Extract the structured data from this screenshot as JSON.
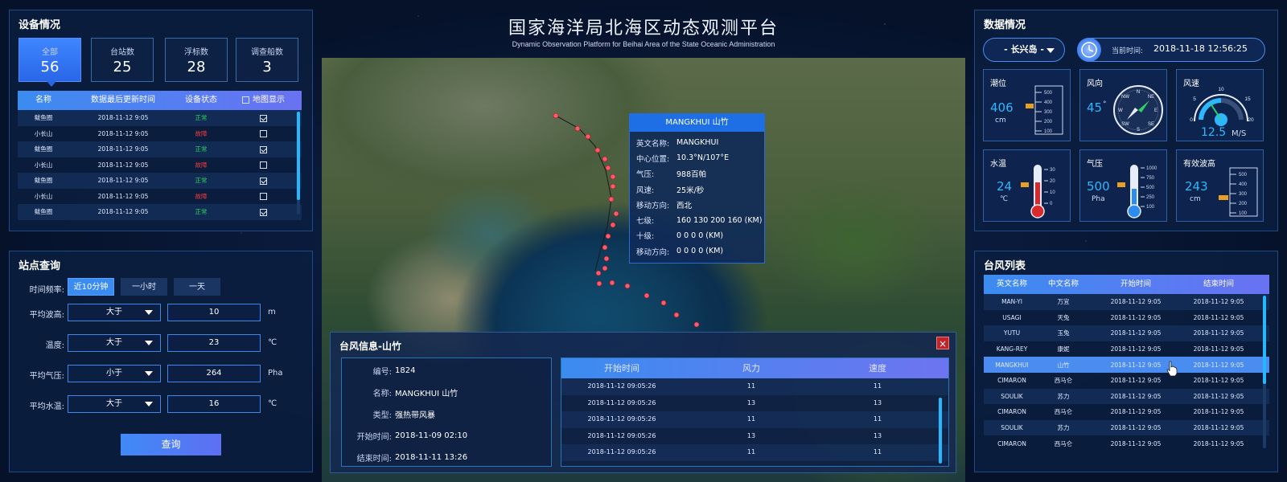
{
  "header": {
    "title": "国家海洋局北海区动态观测平台",
    "subtitle": "Dynamic Observation Platform for Beihai Area of the State Oceanic Administration"
  },
  "device_panel": {
    "title": "设备情况",
    "stats": [
      {
        "label": "全部",
        "value": "56"
      },
      {
        "label": "台站数",
        "value": "25"
      },
      {
        "label": "浮标数",
        "value": "28"
      },
      {
        "label": "调查船数",
        "value": "3"
      }
    ],
    "columns": [
      "名称",
      "数据最后更新时间",
      "设备状态",
      "地图显示"
    ],
    "rows": [
      {
        "name": "鲅鱼圈",
        "time": "2018-11-12 9:05",
        "status": "正常",
        "ok": true,
        "shown": true
      },
      {
        "name": "小长山",
        "time": "2018-11-12 9:05",
        "status": "故障",
        "ok": false,
        "shown": false
      },
      {
        "name": "鲅鱼圈",
        "time": "2018-11-12 9:05",
        "status": "正常",
        "ok": true,
        "shown": true
      },
      {
        "name": "小长山",
        "time": "2018-11-12 9:05",
        "status": "故障",
        "ok": false,
        "shown": false
      },
      {
        "name": "鲅鱼圈",
        "time": "2018-11-12 9:05",
        "status": "正常",
        "ok": true,
        "shown": true
      },
      {
        "name": "小长山",
        "time": "2018-11-12 9:05",
        "status": "故障",
        "ok": false,
        "shown": false
      },
      {
        "name": "鲅鱼圈",
        "time": "2018-11-12 9:05",
        "status": "正常",
        "ok": true,
        "shown": true
      }
    ]
  },
  "station_query": {
    "title": "站点查询",
    "freq_label": "时间频率:",
    "freq_options": [
      "近10分钟",
      "一小时",
      "一天"
    ],
    "filters": [
      {
        "label": "平均波高:",
        "op": "大于",
        "value": "10",
        "unit": "m"
      },
      {
        "label": "温度:",
        "op": "大于",
        "value": "23",
        "unit": "℃"
      },
      {
        "label": "平均气压:",
        "op": "小于",
        "value": "264",
        "unit": "Pha"
      },
      {
        "label": "平均水温:",
        "op": "大于",
        "value": "16",
        "unit": "℃"
      }
    ],
    "query_button": "查询"
  },
  "data_panel": {
    "title": "数据情况",
    "location": "- 长兴岛 -",
    "time_label": "当前时间:",
    "time_value": "2018-11-18 12:56:25",
    "tiles": {
      "tide": {
        "title": "潮位",
        "value": "406",
        "unit": "cm",
        "ticks": [
          "500",
          "400",
          "300",
          "200",
          "100"
        ]
      },
      "wind_dir": {
        "title": "风向",
        "value": "45",
        "unit": "°",
        "compass": [
          "N",
          "NE",
          "E",
          "SE",
          "S",
          "SW",
          "W",
          "NW"
        ]
      },
      "wind_speed": {
        "title": "风速",
        "value": "12.5",
        "unit": "M/S",
        "ticks": [
          "0",
          "5",
          "10",
          "15",
          "20"
        ]
      },
      "water_temp": {
        "title": "水温",
        "value": "24",
        "unit": "℃",
        "ticks": [
          "30",
          "20",
          "10",
          "0"
        ]
      },
      "pressure": {
        "title": "气压",
        "value": "500",
        "unit": "Pha",
        "ticks": [
          "1000",
          "750",
          "500",
          "250",
          "100"
        ]
      },
      "wave_height": {
        "title": "有效波高",
        "value": "243",
        "unit": "cm",
        "ticks": [
          "500",
          "400",
          "300",
          "200",
          "100"
        ]
      }
    }
  },
  "typhoon_list": {
    "title": "台风列表",
    "columns": [
      "英文名称",
      "中文名称",
      "开始时间",
      "结束时间"
    ],
    "rows": [
      {
        "en": "MAN-YI",
        "cn": "万宜",
        "start": "2018-11-12 9:05",
        "end": "2018-11-12 9:05"
      },
      {
        "en": "USAGI",
        "cn": "天兔",
        "start": "2018-11-12 9:05",
        "end": "2018-11-12 9:05"
      },
      {
        "en": "YUTU",
        "cn": "玉兔",
        "start": "2018-11-12 9:05",
        "end": "2018-11-12 9:05"
      },
      {
        "en": "KANG-REY",
        "cn": "康妮",
        "start": "2018-11-12 9:05",
        "end": "2018-11-12 9:05"
      },
      {
        "en": "MANGKHUI",
        "cn": "山竹",
        "start": "2018-11-12 9:05",
        "end": "2018-11-12 9:05",
        "selected": true
      },
      {
        "en": "CIMARON",
        "cn": "西马仑",
        "start": "2018-11-12 9:05",
        "end": "2018-11-12 9:05"
      },
      {
        "en": "SOULIK",
        "cn": "苏力",
        "start": "2018-11-12 9:05",
        "end": "2018-11-12 9:05"
      },
      {
        "en": "CIMARON",
        "cn": "西马仑",
        "start": "2018-11-12 9:05",
        "end": "2018-11-12 9:05"
      },
      {
        "en": "SOULIK",
        "cn": "苏力",
        "start": "2018-11-12 9:05",
        "end": "2018-11-12 9:05"
      },
      {
        "en": "CIMARON",
        "cn": "西马仑",
        "start": "2018-11-12 9:05",
        "end": "2018-11-12 9:05"
      }
    ]
  },
  "map_tooltip": {
    "title": "MANGKHUI 山竹",
    "rows": [
      {
        "k": "英文名称:",
        "v": "MANGKHUI"
      },
      {
        "k": "中心位置:",
        "v": "10.3°N/107°E"
      },
      {
        "k": "气压:",
        "v": "988百帕"
      },
      {
        "k": "风速:",
        "v": "25米/秒"
      },
      {
        "k": "移动方向:",
        "v": "西北"
      },
      {
        "k": "七级:",
        "v": "160 130 200 160 (KM)"
      },
      {
        "k": "十级:",
        "v": "0 0 0 0 (KM)"
      },
      {
        "k": "移动方向:",
        "v": "0 0 0 0 (KM)"
      }
    ]
  },
  "typhoon_dialog": {
    "title": "台风信息-山竹",
    "close_icon": "×",
    "info": [
      {
        "k": "编号:",
        "v": "1824"
      },
      {
        "k": "名称:",
        "v": "MANGKHUI 山竹"
      },
      {
        "k": "类型:",
        "v": "强热带风暴"
      },
      {
        "k": "开始时间:",
        "v": "2018-11-09 02:10"
      },
      {
        "k": "结束时间:",
        "v": "2018-11-11 13:26"
      }
    ],
    "columns": [
      "开始时间",
      "风力",
      "速度"
    ],
    "rows": [
      {
        "time": "2018-11-12 09:05:26",
        "force": "11",
        "speed": "11"
      },
      {
        "time": "2018-11-12 09:05:26",
        "force": "13",
        "speed": "13"
      },
      {
        "time": "2018-11-12 09:05:26",
        "force": "11",
        "speed": "11"
      },
      {
        "time": "2018-11-12 09:05:26",
        "force": "13",
        "speed": "13"
      },
      {
        "time": "2018-11-12 09:05:26",
        "force": "11",
        "speed": "11"
      },
      {
        "time": "2018-11-12 09:05:26",
        "force": "13",
        "speed": "13"
      }
    ]
  },
  "colors": {
    "accent": "#3b8cf0",
    "ok": "#2ad25a",
    "fault": "#f03a3a",
    "track": "#ff5a6a"
  }
}
